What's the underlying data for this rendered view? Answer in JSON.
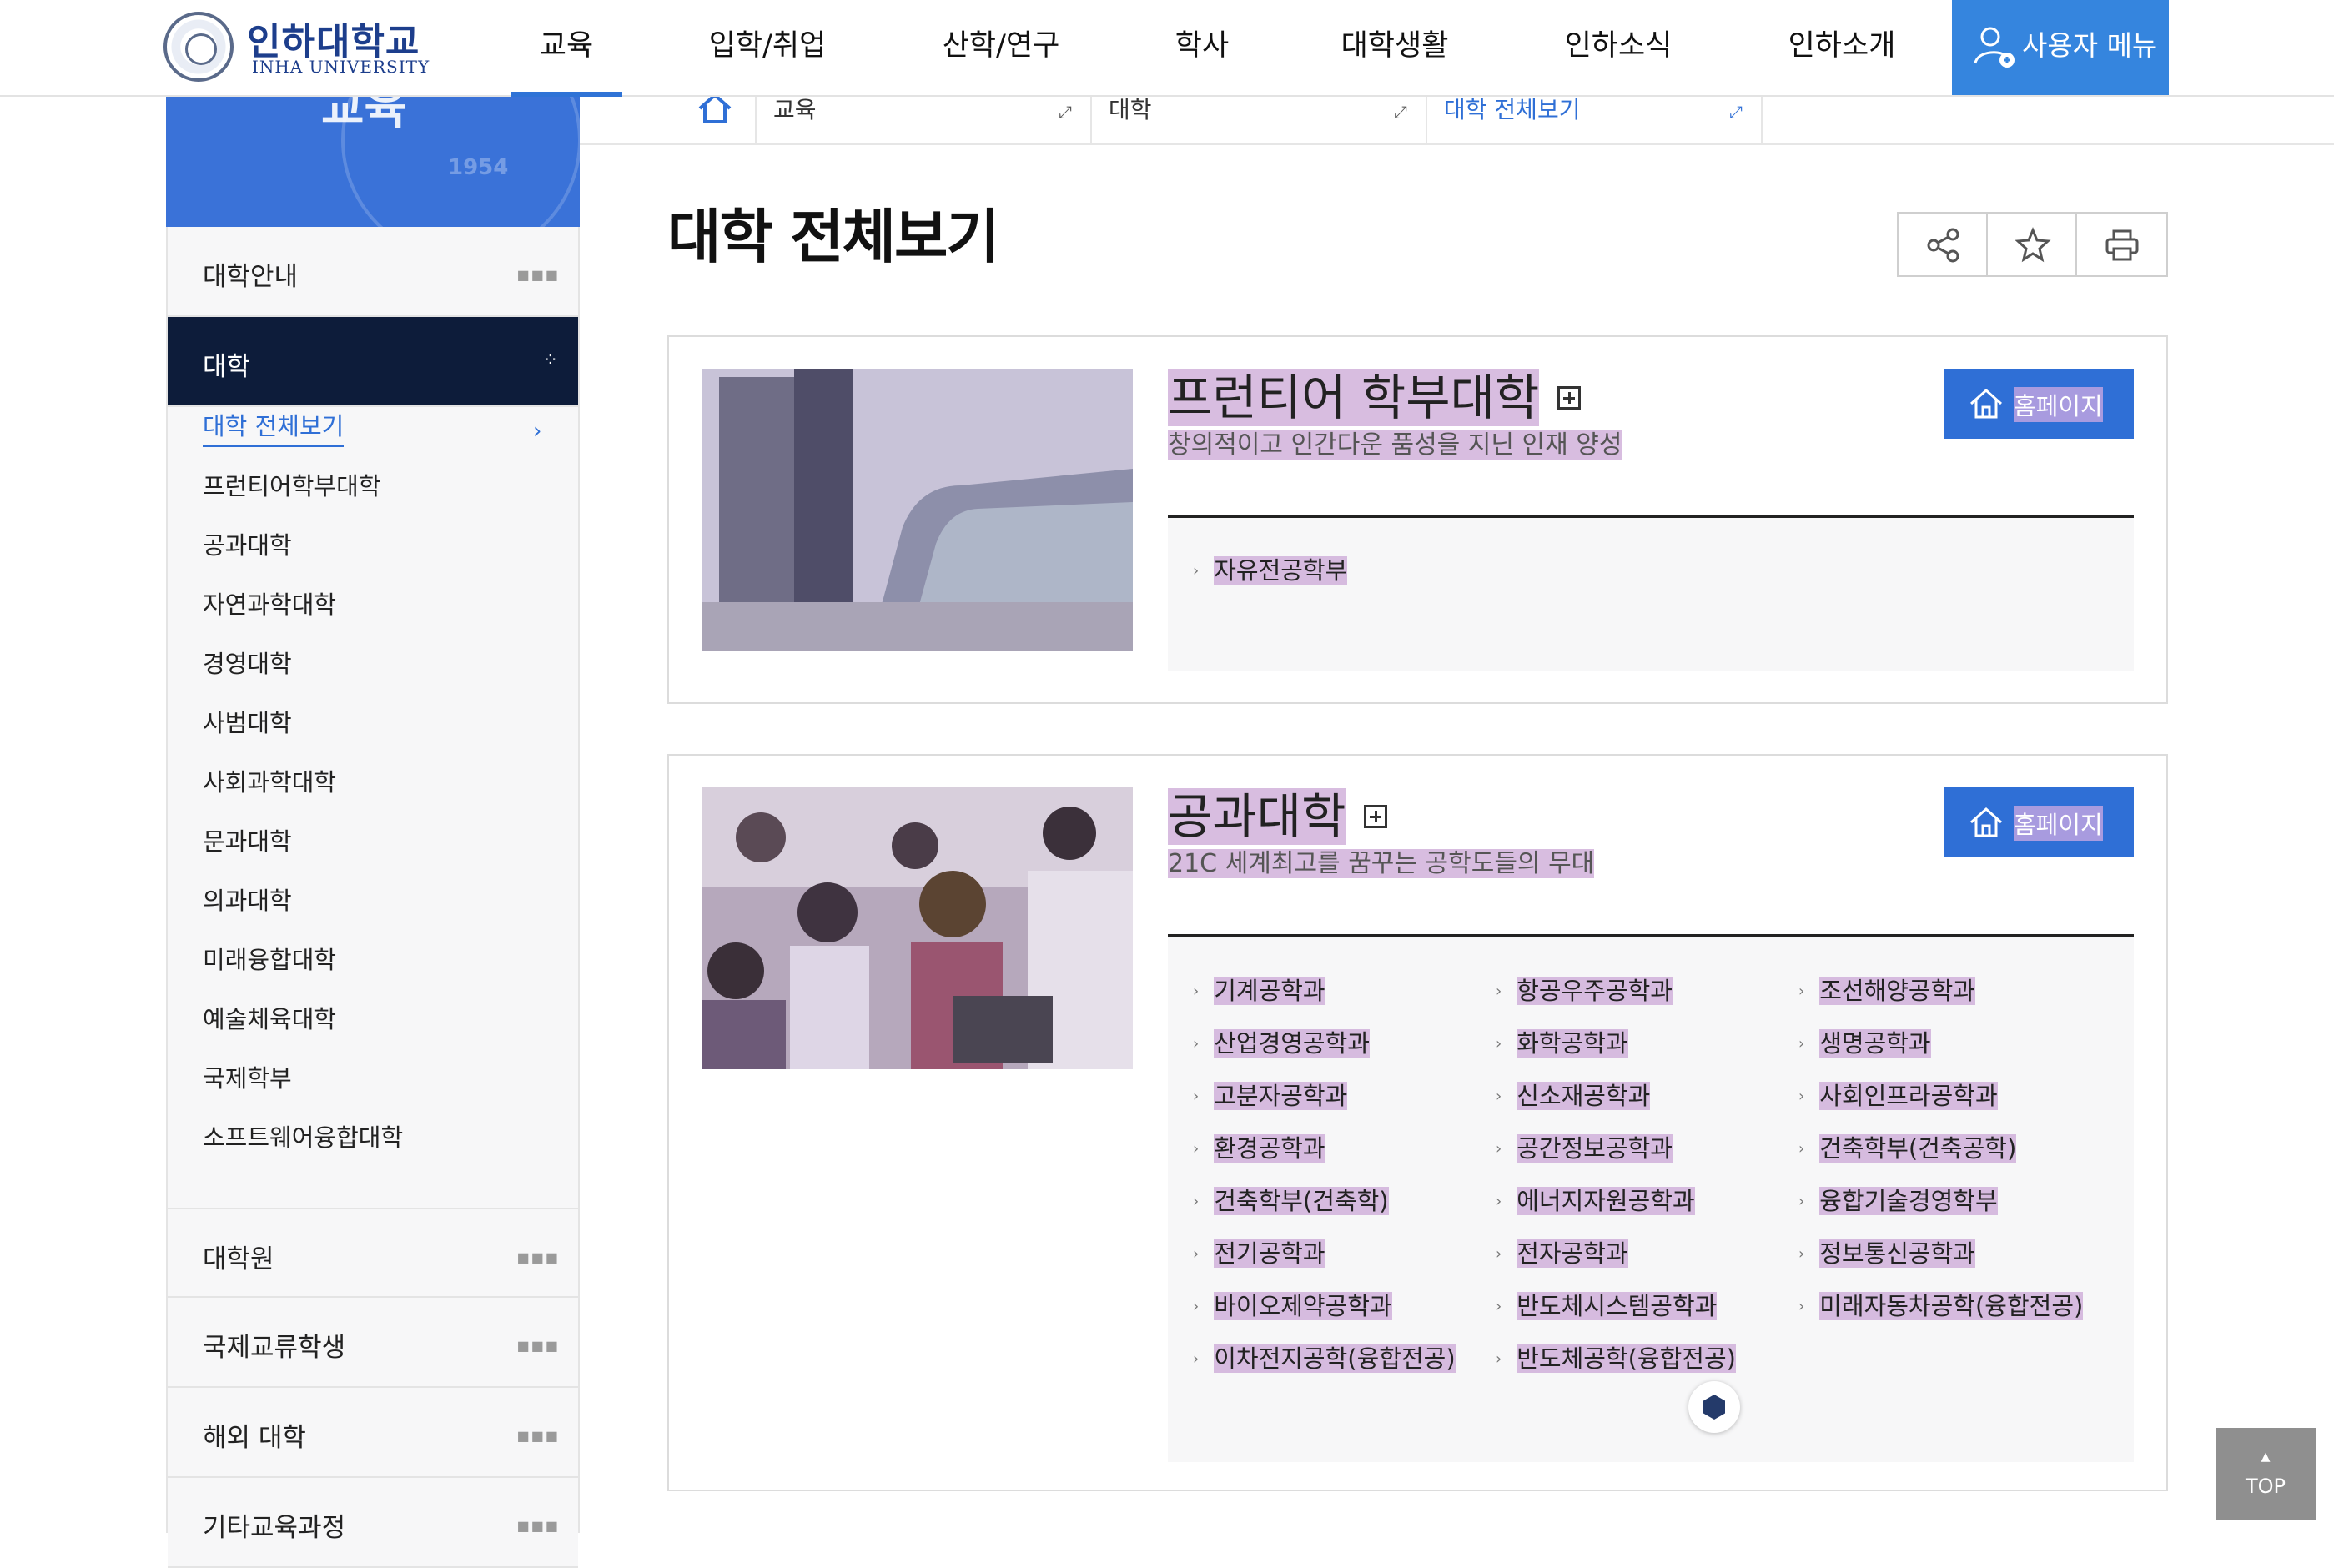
{
  "header": {
    "logo_ko": "인하대학교",
    "logo_en": "INHA UNIVERSITY",
    "nav": [
      "교육",
      "입학/취업",
      "산학/연구",
      "학사",
      "대학생활",
      "인하소식",
      "인하소개"
    ],
    "user_menu": "사용자 메뉴"
  },
  "banner": {
    "title": "교육",
    "year": "1954"
  },
  "breadcrumb": [
    "교육",
    "대학",
    "대학 전체보기"
  ],
  "sidebar": {
    "top": "대학안내",
    "active": "대학",
    "sub": [
      "대학 전체보기",
      "프런티어학부대학",
      "공과대학",
      "자연과학대학",
      "경영대학",
      "사범대학",
      "사회과학대학",
      "문과대학",
      "의과대학",
      "미래융합대학",
      "예술체육대학",
      "국제학부",
      "소프트웨어융합대학"
    ],
    "bottom": [
      "대학원",
      "국제교류학생",
      "해외 대학",
      "기타교육과정"
    ]
  },
  "page": {
    "title": "대학 전체보기"
  },
  "cards": [
    {
      "name": "프런티어 학부대학",
      "desc": "창의적이고 인간다운 품성을 지닌 인재 양성",
      "home": "홈페이지",
      "depts": [
        "자유전공학부"
      ]
    },
    {
      "name": "공과대학",
      "desc": "21C 세계최고를 꿈꾸는 공학도들의 무대",
      "home": "홈페이지",
      "depts": [
        [
          "기계공학과",
          "항공우주공학과",
          "조선해양공학과"
        ],
        [
          "산업경영공학과",
          "화학공학과",
          "생명공학과"
        ],
        [
          "고분자공학과",
          "신소재공학과",
          "사회인프라공학과"
        ],
        [
          "환경공학과",
          "공간정보공학과",
          "건축학부(건축공학)"
        ],
        [
          "건축학부(건축학)",
          "에너지자원공학과",
          "융합기술경영학부"
        ],
        [
          "전기공학과",
          "전자공학과",
          "정보통신공학과"
        ],
        [
          "바이오제약공학과",
          "반도체시스템공학과",
          "미래자동차공학(융합전공)"
        ],
        [
          "이차전지공학(융합전공)",
          "반도체공학(융합전공)",
          ""
        ]
      ]
    }
  ],
  "top_button": "TOP"
}
